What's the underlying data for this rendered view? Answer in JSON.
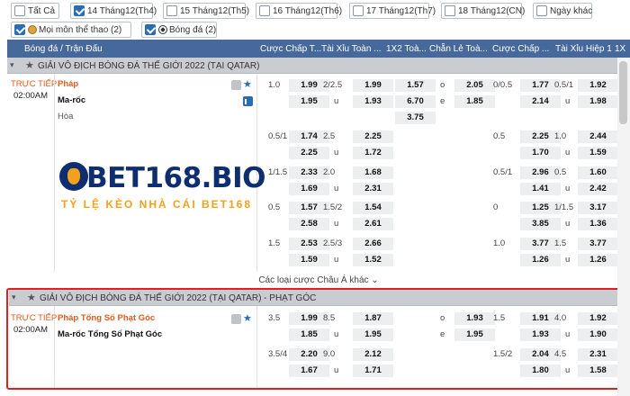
{
  "filters": {
    "all": "Tất Cả",
    "d14": "14 Tháng12(Th4)",
    "d15": "15 Tháng12(Th5)",
    "d16": "16 Tháng12(Th6)",
    "d17": "17 Tháng12(Th7)",
    "d18": "18 Tháng12(CN)",
    "other_day": "Ngày khác",
    "all_sports": "Mọi môn thể thao (2)",
    "football": "Bóng đá (2)"
  },
  "header": {
    "col_match": "Bóng đá / Trận Đấu",
    "col_hdp": "Cược Chấp T...",
    "col_ou": "Tài Xỉu Toàn ...",
    "col_1x2": "1X2 Toà...",
    "col_oe": "Chẵn Lẻ Toà...",
    "col_hdp1": "Cược Chấp ...",
    "col_ou1": "Tài Xỉu Hiệp 1",
    "col_last": "1X"
  },
  "league1": {
    "title": "GIẢI VÔ ĐỊCH BÓNG ĐÁ THẾ GIỚI 2022 (TẠI QATAR)"
  },
  "match1": {
    "live": "TRỰC TIẾP",
    "time": "02:00AM",
    "home": "Pháp",
    "away": "Ma-rốc",
    "draw": "Hòa",
    "rows": [
      {
        "hdp": "1.0",
        "h1": "1.99",
        "h2": "1.95",
        "ou": "2/2.5",
        "o1": "1.99",
        "o2": "1.93",
        "u": "u",
        "x1": "1.57",
        "x2": "6.70",
        "x3": "3.75",
        "oe1": "o",
        "oe1v": "2.05",
        "oe2": "e",
        "oe2v": "1.85",
        "hdp1": "0/0.5",
        "a1": "1.77",
        "a2": "2.14",
        "ou1": "0.5/1",
        "b1": "1.92",
        "b2": "1.98"
      },
      {
        "hdp": "0.5/1",
        "h1": "1.74",
        "h2": "2.25",
        "ou": "2.5",
        "o1": "2.25",
        "o2": "1.72",
        "u": "u",
        "hdp1": "0.5",
        "a1": "2.25",
        "a2": "1.70",
        "ou1": "1.0",
        "b1": "2.44",
        "b2": "1.59"
      },
      {
        "hdp": "1/1.5",
        "h1": "2.33",
        "h2": "1.69",
        "ou": "2.0",
        "o1": "1.68",
        "o2": "2.31",
        "u": "u",
        "hdp1": "0.5/1",
        "a1": "2.96",
        "a2": "1.41",
        "ou1": "0.5",
        "b1": "1.60",
        "b2": "2.42"
      },
      {
        "hdp": "0.5",
        "h1": "1.57",
        "h2": "2.58",
        "ou": "1.5/2",
        "o1": "1.54",
        "o2": "2.61",
        "u": "u",
        "hdp1": "0",
        "a1": "1.25",
        "a2": "3.85",
        "ou1": "1/1.5",
        "b1": "3.17",
        "b2": "1.36"
      },
      {
        "hdp": "1.5",
        "h1": "2.53",
        "h2": "1.59",
        "ou": "2.5/3",
        "o1": "2.66",
        "o2": "1.52",
        "u": "u",
        "hdp1": "1.0",
        "a1": "3.77",
        "a2": "1.26",
        "ou1": "1.5",
        "b1": "3.77",
        "b2": "1.26"
      }
    ]
  },
  "more_bets": "Các loại cược Châu Á khác",
  "logo": {
    "word": "BET168.BIO",
    "tagline": "TỶ LỆ KÈO NHÀ CÁI BET168"
  },
  "league2": {
    "title": "GIẢI VÔ ĐỊCH BÓNG ĐÁ THẾ GIỚI 2022 (TẠI QATAR) - PHẠT GÓC"
  },
  "match2": {
    "live": "TRỰC TIẾP",
    "time": "02:00AM",
    "home": "Pháp Tổng Số Phạt Góc",
    "away": "Ma-rốc Tổng Số Phạt Góc",
    "rows": [
      {
        "hdp": "3.5",
        "h1": "1.99",
        "h2": "1.85",
        "ou": "8.5",
        "o1": "1.87",
        "o2": "1.95",
        "u": "u",
        "oe1": "o",
        "oe1v": "1.93",
        "oe2": "e",
        "oe2v": "1.95",
        "hdp1": "1.5",
        "a1": "1.91",
        "a2": "1.93",
        "ou1": "4.0",
        "b1": "1.92",
        "b2": "1.90"
      },
      {
        "hdp": "3.5/4",
        "h1": "2.20",
        "h2": "1.67",
        "ou": "9.0",
        "o1": "2.12",
        "o2": "1.71",
        "u": "u",
        "hdp1": "1.5/2",
        "a1": "2.04",
        "a2": "1.80",
        "ou1": "4.5",
        "b1": "2.31",
        "b2": "1.58"
      }
    ]
  }
}
